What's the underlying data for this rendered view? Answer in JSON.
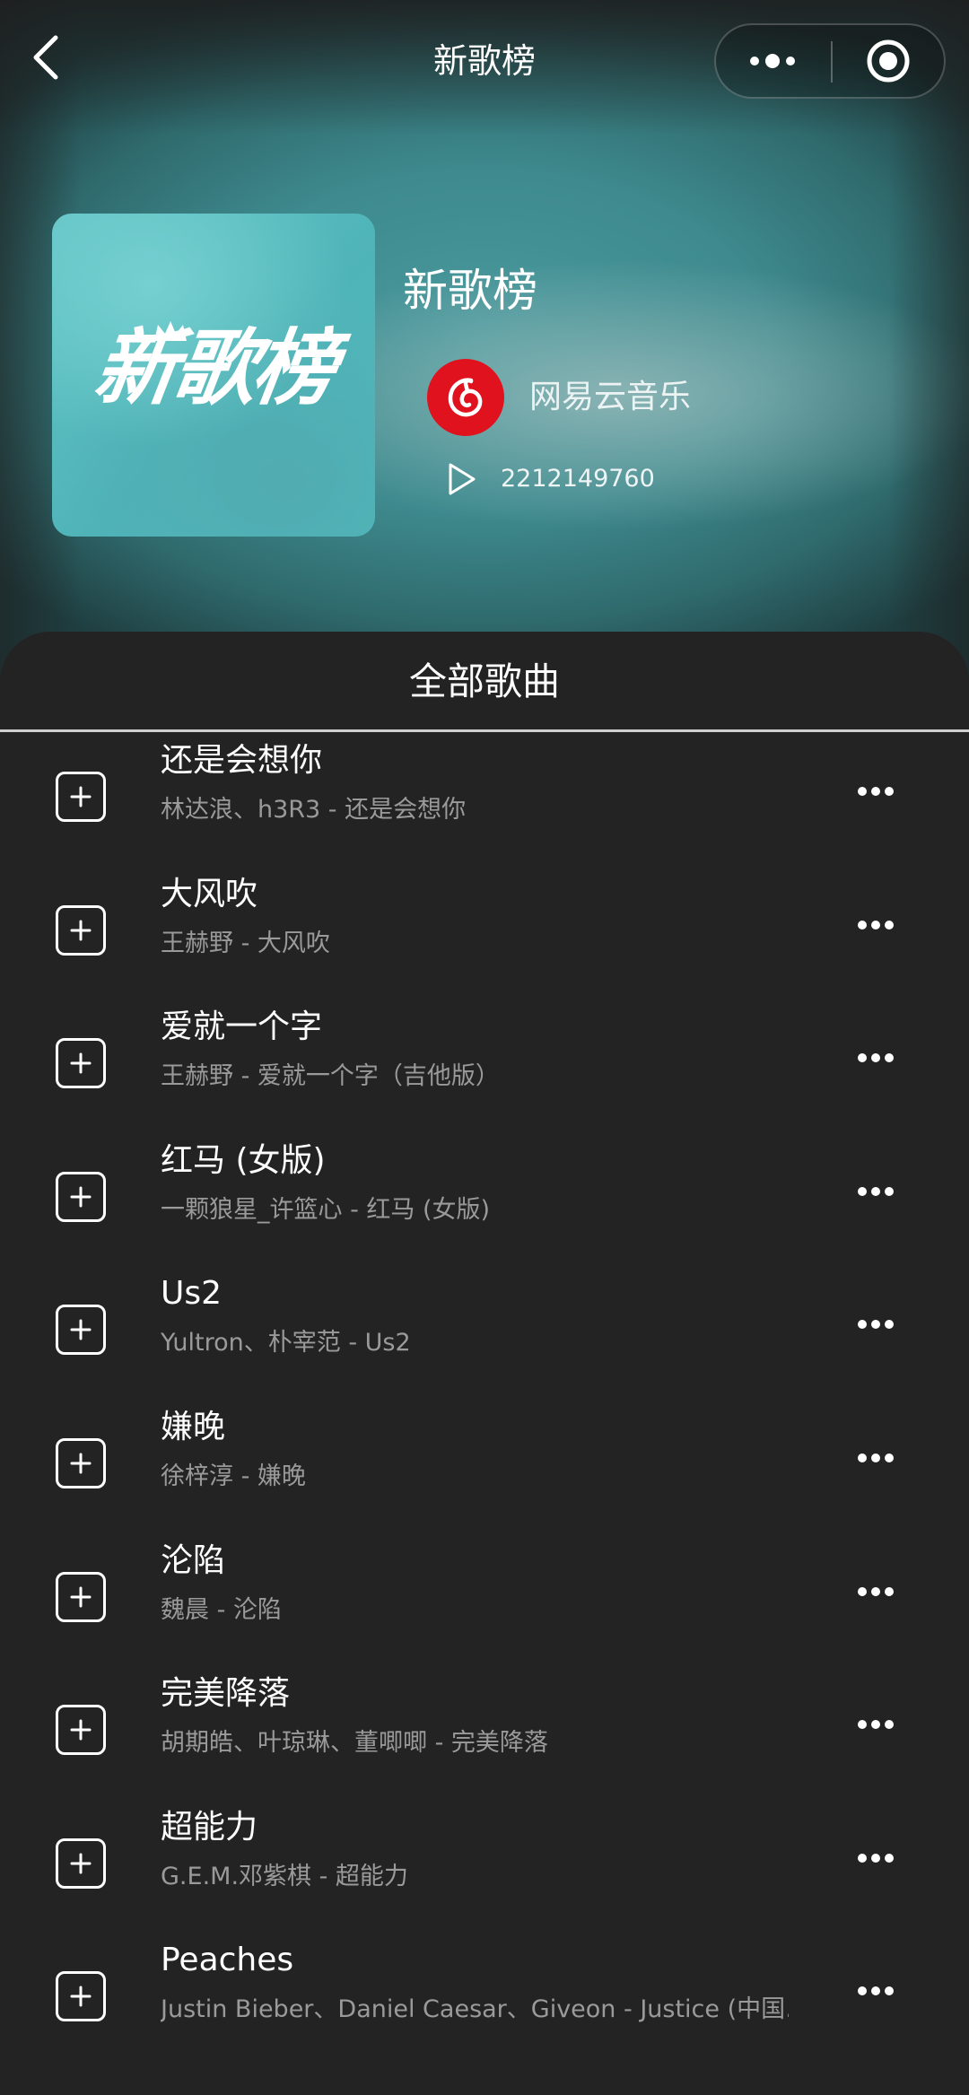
{
  "nav": {
    "title": "新歌榜",
    "back_icon": "chevron-left-icon",
    "more_icon": "more-dots-icon",
    "close_icon": "record-circle-icon"
  },
  "playlist": {
    "cover_text": "新歌榜",
    "title": "新歌榜",
    "creator": "网易云音乐",
    "creator_icon": "netease-music-logo",
    "play_icon": "play-icon",
    "play_count": "2212149760"
  },
  "list": {
    "header": "全部歌曲",
    "songs": [
      {
        "name": "还是会想你",
        "sub": "林达浪、h3R3 - 还是会想你"
      },
      {
        "name": "大风吹",
        "sub": "王赫野 - 大风吹"
      },
      {
        "name": "爱就一个字",
        "sub": "王赫野 - 爱就一个字（吉他版）"
      },
      {
        "name": "红马 (女版)",
        "sub": "一颗狼星_许篮心 - 红马 (女版)"
      },
      {
        "name": "Us2",
        "sub": "Yultron、朴宰范 - Us2"
      },
      {
        "name": "嫌晚",
        "sub": "徐梓淳 - 嫌晚"
      },
      {
        "name": "沦陷",
        "sub": "魏晨 - 沦陷"
      },
      {
        "name": "完美降落",
        "sub": "胡期皓、叶琼琳、董唧唧 - 完美降落"
      },
      {
        "name": "超能力",
        "sub": "G.E.M.邓紫棋 - 超能力"
      },
      {
        "name": "Peaches",
        "sub": "Justin Bieber、Daniel Caesar、Giveon - Justice (中国…"
      }
    ]
  },
  "colors": {
    "background": "#242424",
    "hero_teal": "#4a9a9e",
    "cover_teal": "#5cbfc2",
    "brand_red": "#e0121e",
    "secondary_text": "#9a9a9a"
  }
}
